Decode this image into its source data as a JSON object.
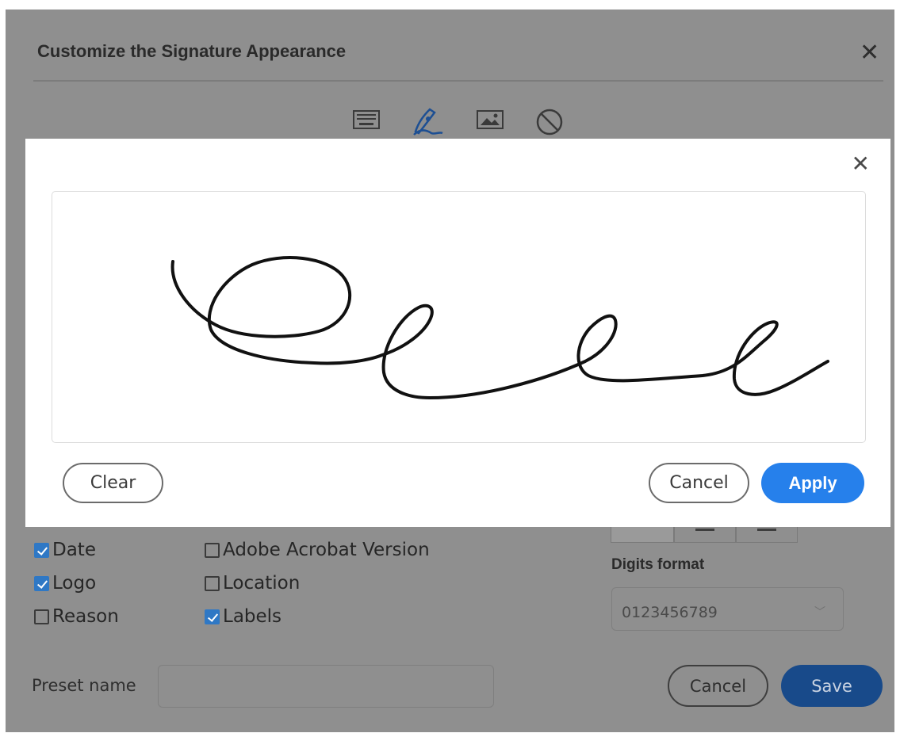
{
  "background_dialog": {
    "title": "Customize the Signature Appearance",
    "mode_icons": [
      "keyboard-icon",
      "pen-draw-icon",
      "image-icon",
      "none-icon"
    ],
    "checkboxes": [
      {
        "label": "Date",
        "checked": true
      },
      {
        "label": "Logo",
        "checked": true
      },
      {
        "label": "Reason",
        "checked": false
      },
      {
        "label": "Adobe Acrobat Version",
        "checked": false
      },
      {
        "label": "Location",
        "checked": false
      },
      {
        "label": "Labels",
        "checked": true
      }
    ],
    "digits_format_label": "Digits format",
    "digits_format_value": "0123456789",
    "preset_name_label": "Preset name",
    "preset_name_value": "",
    "cancel_label": "Cancel",
    "save_label": "Save"
  },
  "draw_modal": {
    "clear_label": "Clear",
    "cancel_label": "Cancel",
    "apply_label": "Apply"
  },
  "colors": {
    "accent": "#2680eb",
    "save_bg": "#184a8a",
    "checkbox_checked": "#2f78c5"
  }
}
